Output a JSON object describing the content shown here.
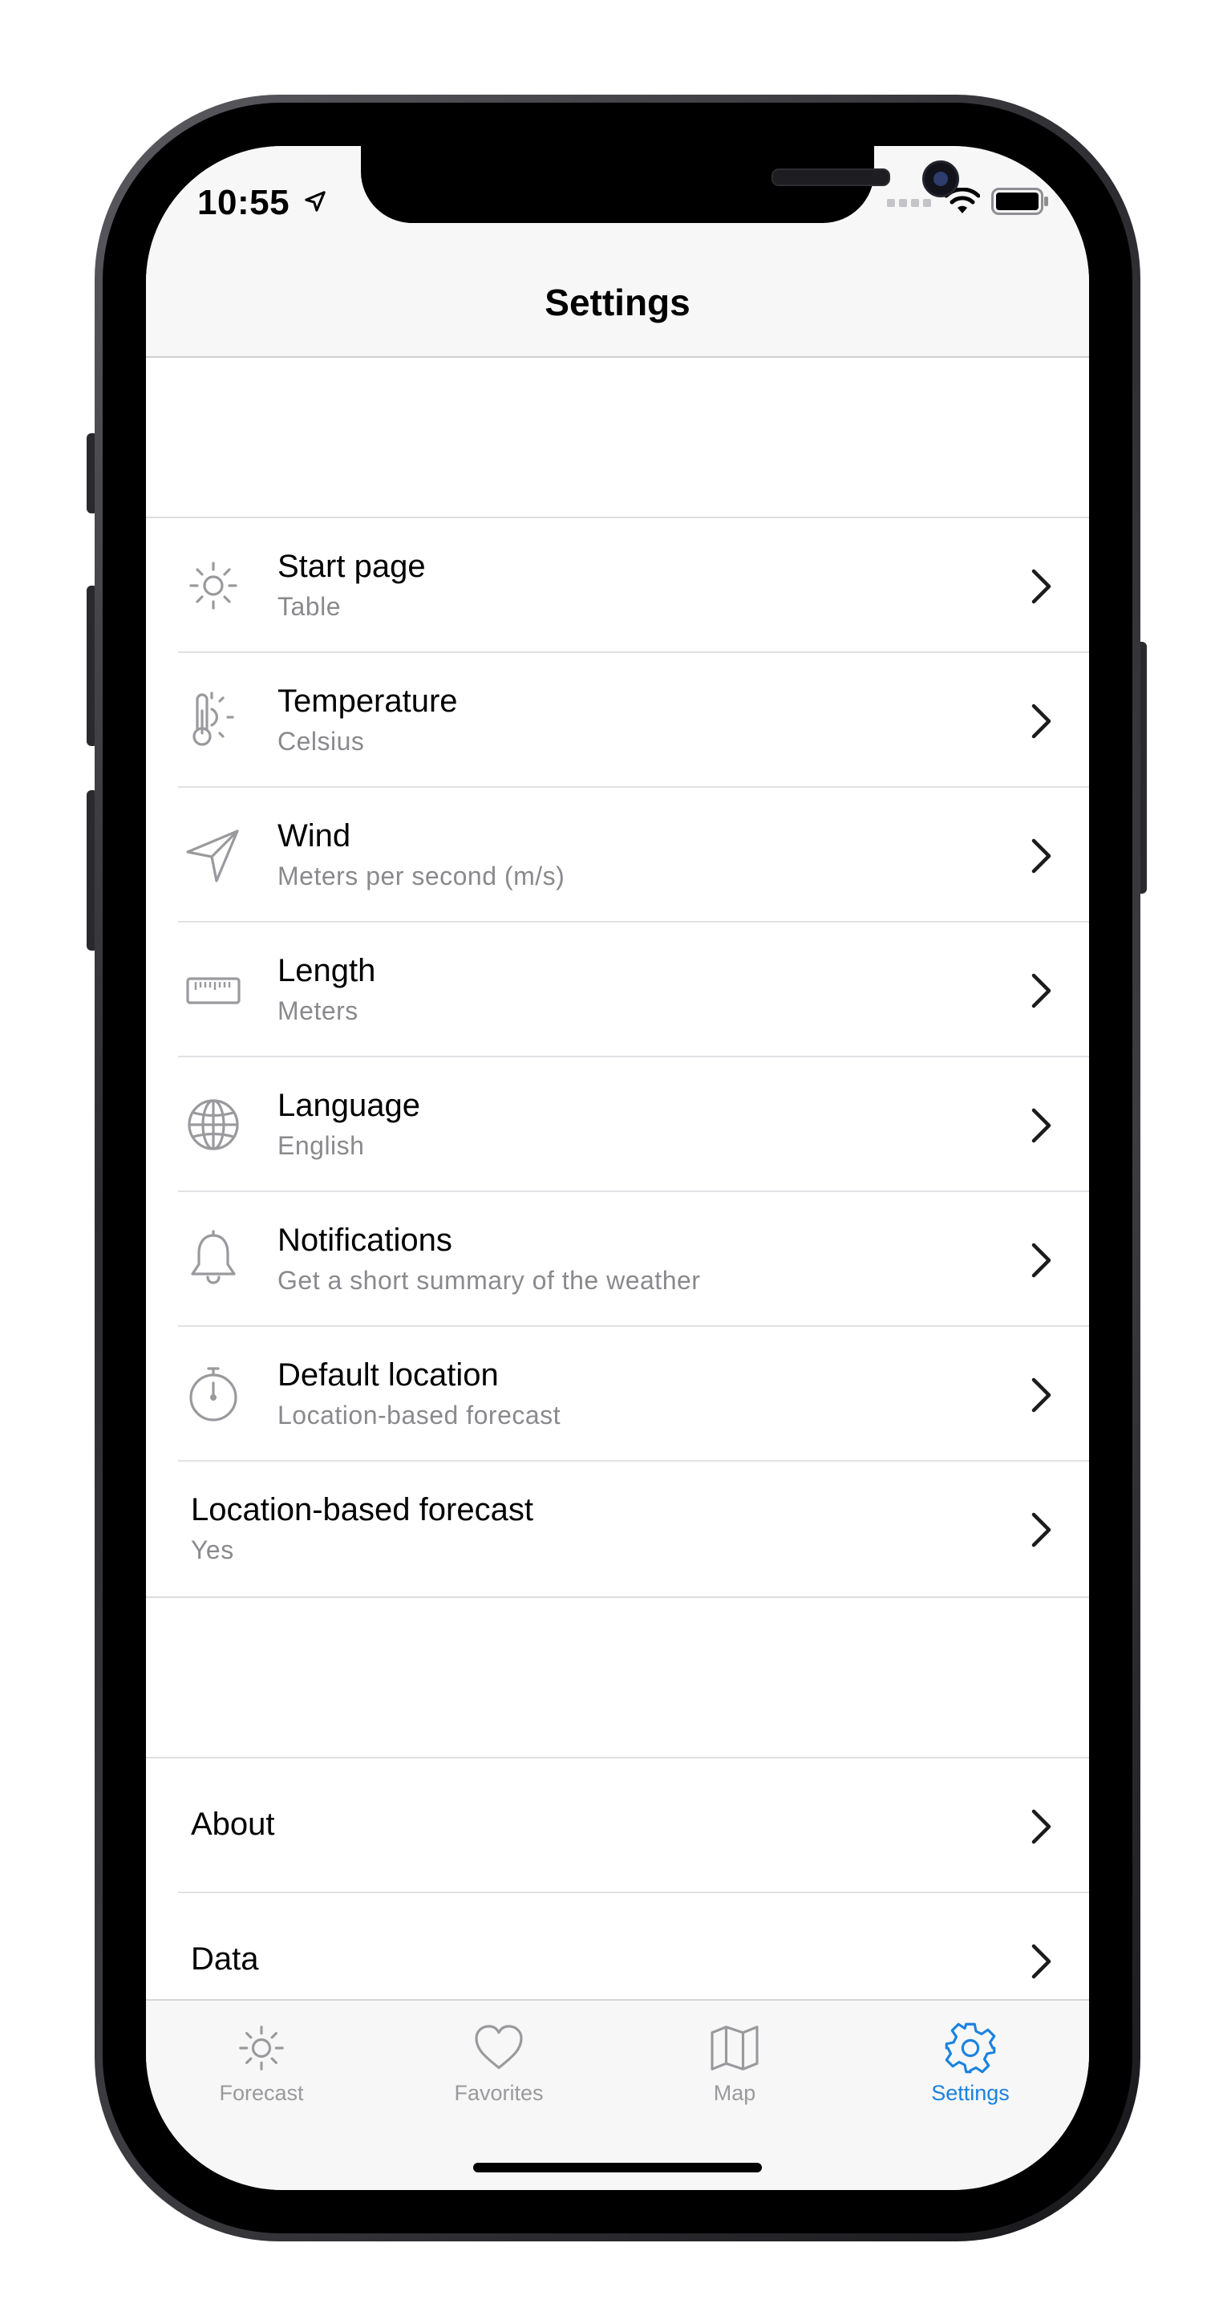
{
  "status_bar": {
    "time": "10:55"
  },
  "header": {
    "title": "Settings"
  },
  "settings": {
    "items": [
      {
        "title": "Start page",
        "subtitle": "Table",
        "icon": "sun-icon"
      },
      {
        "title": "Temperature",
        "subtitle": "Celsius",
        "icon": "thermometer-icon"
      },
      {
        "title": "Wind",
        "subtitle": "Meters per second (m/s)",
        "icon": "navigation-arrow-icon"
      },
      {
        "title": "Length",
        "subtitle": "Meters",
        "icon": "ruler-icon"
      },
      {
        "title": "Language",
        "subtitle": "English",
        "icon": "globe-icon"
      },
      {
        "title": "Notifications",
        "subtitle": "Get a short summary of the weather",
        "icon": "bell-icon"
      },
      {
        "title": "Default location",
        "subtitle": "Location-based forecast",
        "icon": "stopwatch-icon"
      },
      {
        "title": "Location-based forecast",
        "subtitle": "Yes"
      }
    ],
    "info_items": [
      {
        "title": "About"
      },
      {
        "title": "Data"
      }
    ]
  },
  "tabbar": {
    "tabs": [
      {
        "label": "Forecast",
        "icon": "sun-icon"
      },
      {
        "label": "Favorites",
        "icon": "heart-icon"
      },
      {
        "label": "Map",
        "icon": "map-icon"
      },
      {
        "label": "Settings",
        "icon": "gear-icon",
        "active": true
      }
    ]
  },
  "colors": {
    "accent": "#1a82e0",
    "icon_gray": "#9a9a9e",
    "subtitle_gray": "#8a8a8e",
    "background": "#f7f7f7"
  }
}
